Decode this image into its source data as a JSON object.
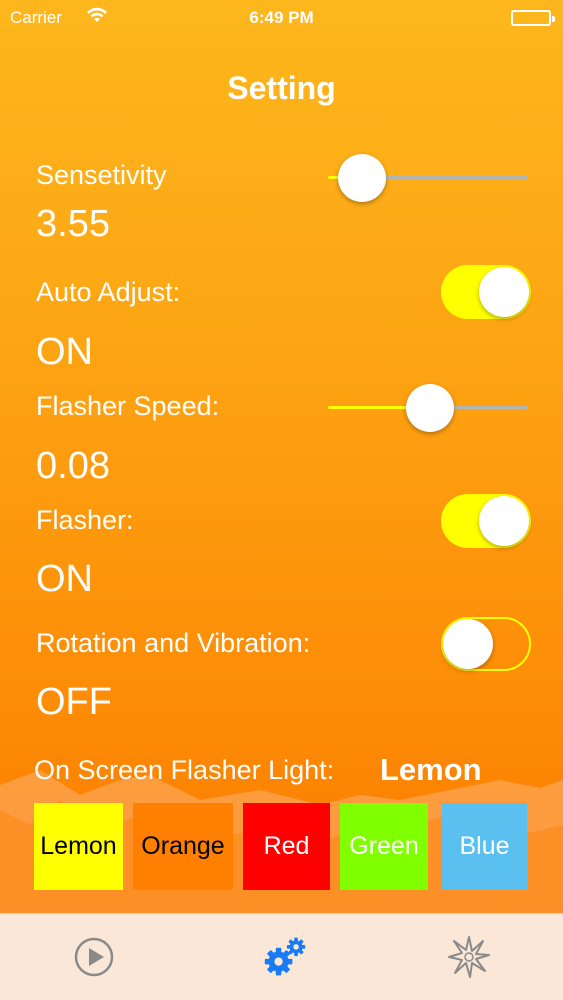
{
  "status_bar": {
    "carrier": "Carrier",
    "time": "6:49 PM",
    "icons": [
      "wifi-icon",
      "battery-icon"
    ]
  },
  "title": "Setting",
  "sensitivity": {
    "label": "Sensetivity",
    "value": "3.55",
    "slider_fraction": 0.17
  },
  "auto_adjust": {
    "label": "Auto Adjust:",
    "state": "ON",
    "toggle_on": true
  },
  "flasher_speed": {
    "label": "Flasher Speed:",
    "value": "0.08",
    "slider_fraction": 0.51
  },
  "flasher": {
    "label": "Flasher:",
    "state": "ON",
    "toggle_on": true
  },
  "rotation_vibration": {
    "label": "Rotation and Vibration:",
    "state": "OFF",
    "toggle_on": false
  },
  "flasher_light": {
    "label": "On Screen Flasher Light:",
    "selected": "Lemon",
    "options": [
      {
        "label": "Lemon",
        "color": "#ffff00",
        "text_color": "#000000"
      },
      {
        "label": "Orange",
        "color": "#ff7f00",
        "text_color": "#000000"
      },
      {
        "label": "Red",
        "color": "#ff0000",
        "text_color": "#ffffff"
      },
      {
        "label": "Green",
        "color": "#80ff00",
        "text_color": "#ffffff"
      },
      {
        "label": "Blue",
        "color": "#5ac0f0",
        "text_color": "#ffffff"
      }
    ]
  },
  "tab_bar": {
    "tabs": [
      {
        "icon": "play-icon",
        "active": false
      },
      {
        "icon": "gears-icon",
        "active": true
      },
      {
        "icon": "burst-icon",
        "active": false
      }
    ],
    "active_color": "#1a7cf5",
    "inactive_color": "#8a8a8a"
  }
}
